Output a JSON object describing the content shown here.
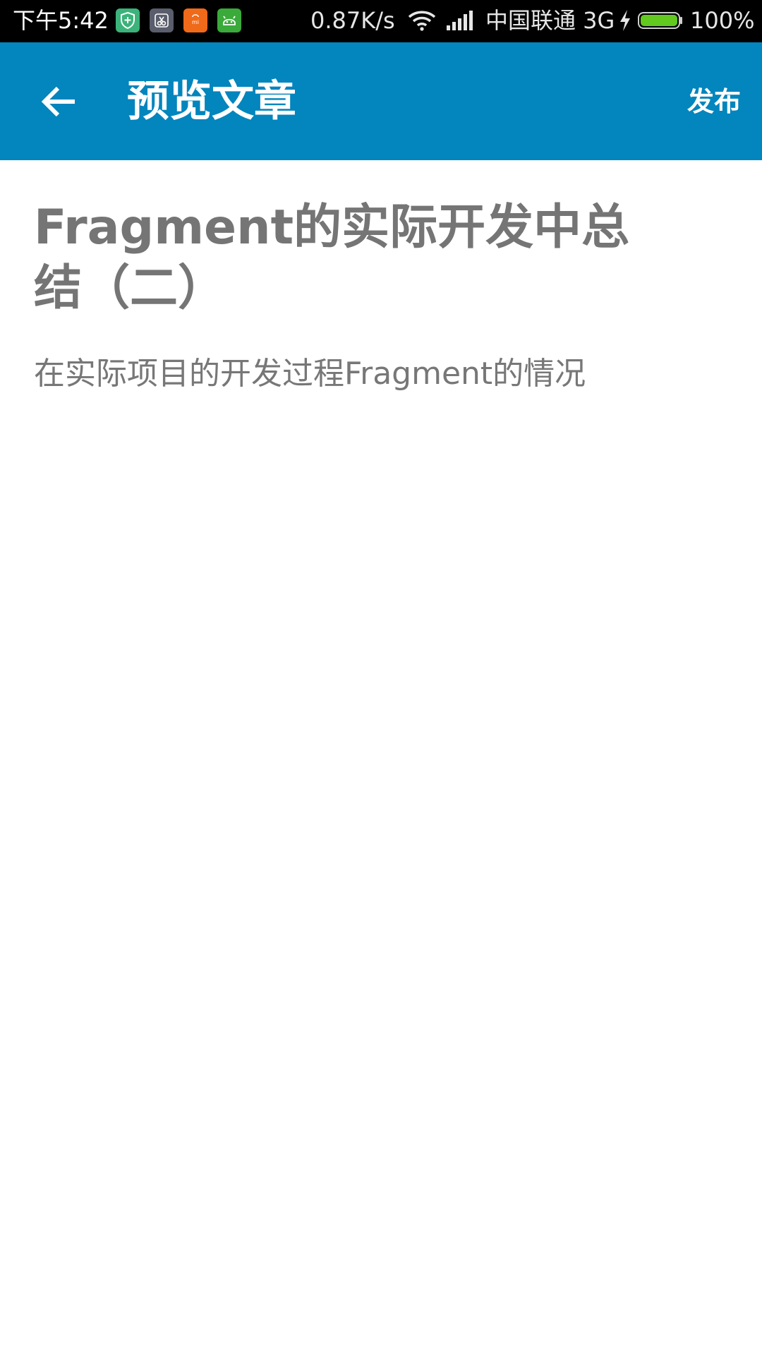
{
  "status_bar": {
    "time": "下午5:42",
    "app_icons": [
      {
        "name": "shield-icon",
        "color": "#3bb37a"
      },
      {
        "name": "scissors-icon",
        "color": "#5a5d6b"
      },
      {
        "name": "mi-store-icon",
        "color": "#f06a1a"
      },
      {
        "name": "android-icon",
        "color": "#3aaa3a"
      }
    ],
    "network_speed": "0.87K/s",
    "carrier": "中国联通 3G",
    "battery_percent": "100%",
    "battery_level": 1.0
  },
  "toolbar": {
    "background_color": "#0385bd",
    "title": "预览文章",
    "publish_label": "发布"
  },
  "article": {
    "title": "Fragment的实际开发中总结（二）",
    "summary": "在实际项目的开发过程Fragment的情况"
  }
}
